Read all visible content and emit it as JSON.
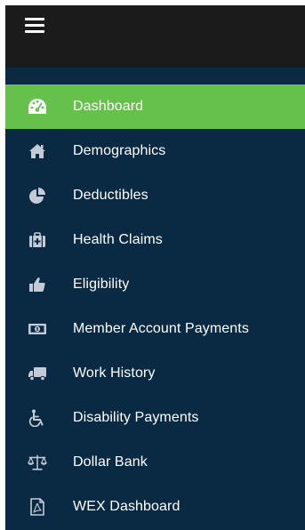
{
  "header": {
    "menu_icon": "hamburger-icon",
    "background": "#1b1b1b"
  },
  "sidebar": {
    "background": "#0a2a44",
    "active_color": "#66c14c",
    "items": [
      {
        "label": "Dashboard",
        "icon": "dashboard-gauge-icon",
        "active": true
      },
      {
        "label": "Demographics",
        "icon": "home-icon",
        "active": false
      },
      {
        "label": "Deductibles",
        "icon": "pie-chart-icon",
        "active": false
      },
      {
        "label": "Health Claims",
        "icon": "medical-kit-icon",
        "active": false
      },
      {
        "label": "Eligibility",
        "icon": "thumbs-up-icon",
        "active": false
      },
      {
        "label": "Member Account Payments",
        "icon": "money-bill-icon",
        "active": false
      },
      {
        "label": "Work History",
        "icon": "truck-icon",
        "active": false
      },
      {
        "label": "Disability Payments",
        "icon": "wheelchair-icon",
        "active": false
      },
      {
        "label": "Dollar Bank",
        "icon": "balance-scale-icon",
        "active": false
      },
      {
        "label": "WEX Dashboard",
        "icon": "pdf-file-icon",
        "active": false
      }
    ]
  }
}
